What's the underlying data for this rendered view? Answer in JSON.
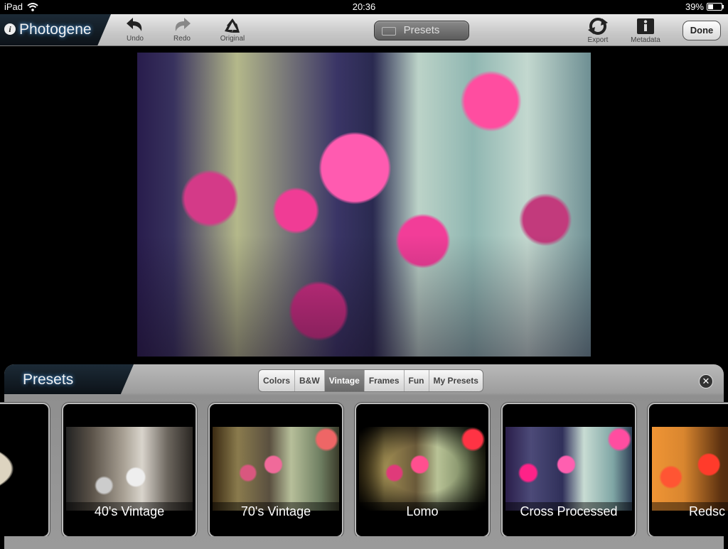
{
  "status": {
    "device": "iPad",
    "time": "20:36",
    "battery_pct": "39%",
    "battery_level": 0.39
  },
  "toolbar": {
    "app_name": "Photogene",
    "undo": "Undo",
    "redo": "Redo",
    "original": "Original",
    "presets": "Presets",
    "export": "Export",
    "metadata": "Metadata",
    "done": "Done"
  },
  "panel": {
    "title": "Presets",
    "tabs": [
      "Colors",
      "B&W",
      "Vintage",
      "Frames",
      "Fun",
      "My Presets"
    ],
    "selected_tab": "Vintage",
    "presets": [
      {
        "label": "ge",
        "thumb": "sepia-oval"
      },
      {
        "label": "40's Vintage",
        "thumb": "bw"
      },
      {
        "label": "70's Vintage",
        "thumb": "warm-faded"
      },
      {
        "label": "Lomo",
        "thumb": "lomo"
      },
      {
        "label": "Cross Processed",
        "thumb": "cross"
      },
      {
        "label": "Redsc",
        "thumb": "red"
      }
    ]
  }
}
